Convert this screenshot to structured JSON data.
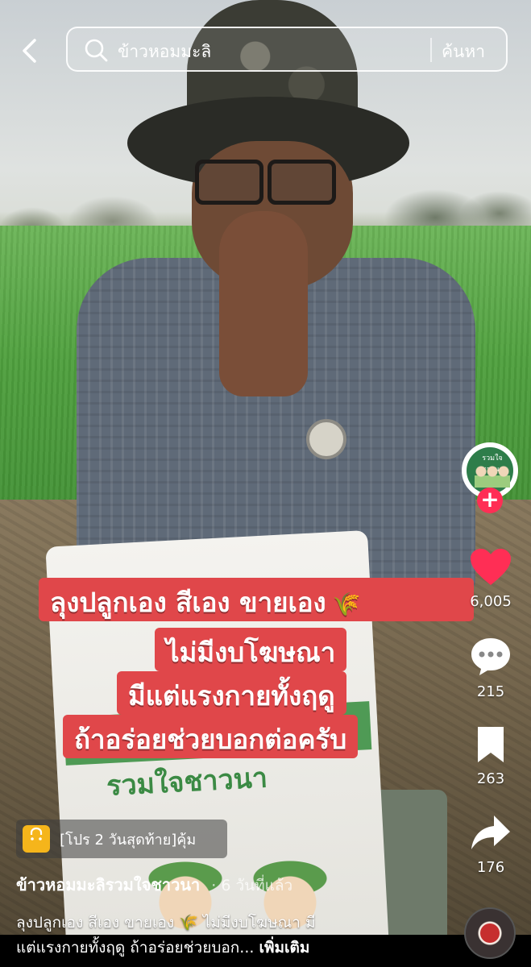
{
  "search": {
    "query": "ข้าวหอมมะลิ",
    "button_label": "ค้นหา"
  },
  "overlay": {
    "line1": "ลุงปลูกเอง สีเอง ขายเอง",
    "line1_emoji": "🌾",
    "line2": "ไม่มีงบโฆษณา",
    "line3": "มีแต่แรงกายทั้งฤดู",
    "line4": "ถ้าอร่อยช่วยบอกต่อครับ"
  },
  "creator": {
    "avatar_label": "รวมใจชาวนา"
  },
  "actions": {
    "likes": "6,005",
    "comments": "215",
    "saves": "263",
    "shares": "176"
  },
  "promo": {
    "label": "[โปร 2 วันสุดท้าย]คุ้ม"
  },
  "post": {
    "account": "ข้าวหอมมะลิรวมใจชาวนา",
    "time": "· 6 วันที่แล้ว",
    "caption_line1": "ลุงปลูกเอง สีเอง ขายเอง 🌾 ไม่มีงบโฆษณา มี",
    "caption_line2": "แต่แรงกายทั้งฤดู ถ้าอร่อยช่วยบอก...",
    "more_label": "เพิ่มเติม"
  },
  "sack": {
    "brand_text": "รวมใจชาวนา"
  },
  "colors": {
    "banner_red": "#e0474a",
    "like_red": "#ff2e55",
    "promo_bag": "#f5b51b"
  }
}
